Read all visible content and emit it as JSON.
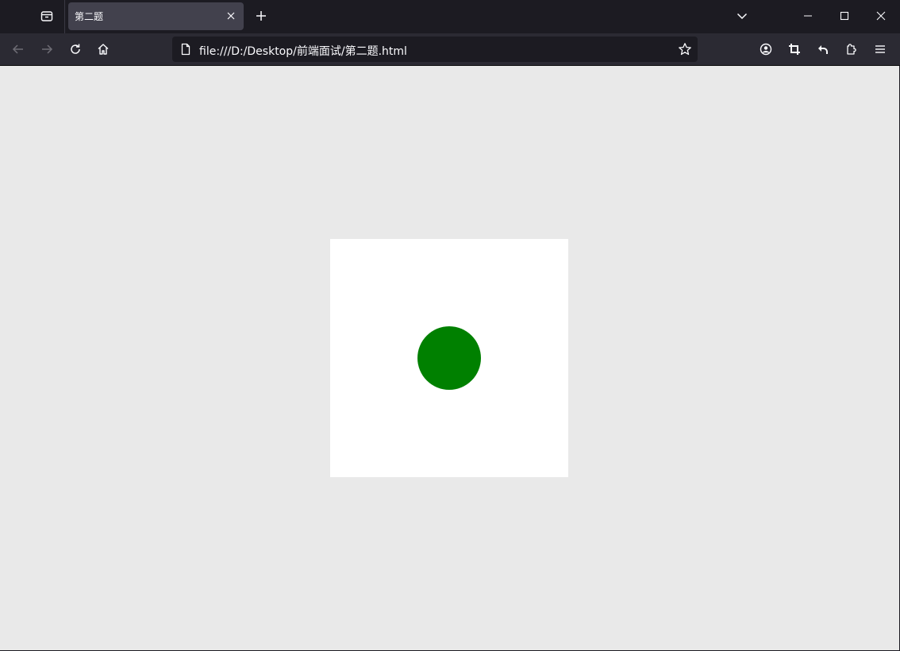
{
  "tab": {
    "title": "第二题"
  },
  "urlbar": {
    "url": "file:///D:/Desktop/前端面试/第二题.html"
  },
  "icons": {
    "tabs_menu": "firefox-view-icon",
    "tab_close": "close-icon",
    "new_tab": "plus-icon",
    "list_tabs": "chevron-down-icon",
    "minimize": "minimize-icon",
    "maximize": "maximize-icon",
    "close_window": "close-icon",
    "back": "back-arrow-icon",
    "forward": "forward-arrow-icon",
    "reload": "reload-icon",
    "home": "home-icon",
    "page": "page-icon",
    "bookmark": "star-icon",
    "account": "account-icon",
    "screenshot": "crop-icon",
    "undo_close": "undo-icon",
    "extensions": "puzzle-icon",
    "menu": "hamburger-menu-icon"
  },
  "colors": {
    "chrome_dark": "#1c1b22",
    "toolbar": "#2b2a33",
    "tab_selected": "#42414d",
    "page_background": "#e9e9e9",
    "box_background": "#ffffff",
    "circle": "#008000"
  }
}
